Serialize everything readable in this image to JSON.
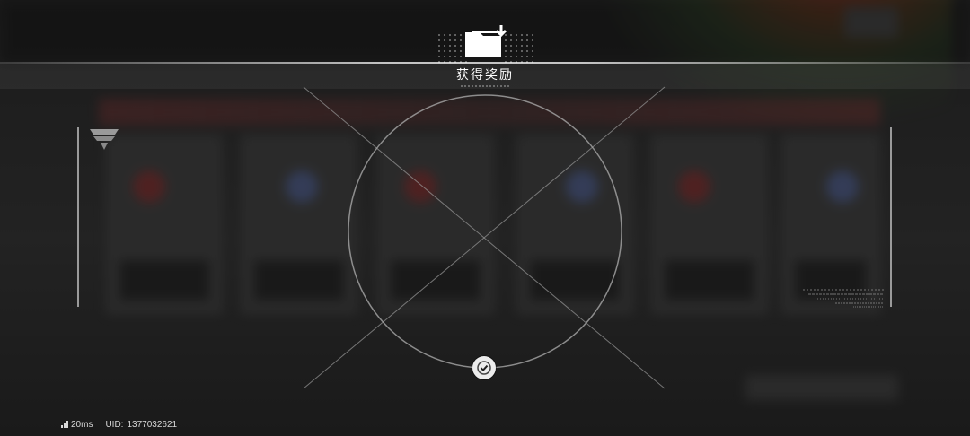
{
  "dialog": {
    "title": "获得奖励",
    "icon": "reward-folder-icon",
    "confirm_icon": "checkmark-icon"
  },
  "status_bar": {
    "ping": "20ms",
    "uid_label": "UID:",
    "uid_value": "1377032621"
  },
  "colors": {
    "accent": "#ffffff",
    "background": "#262626",
    "overlay_lines": "#bdbdbd"
  }
}
